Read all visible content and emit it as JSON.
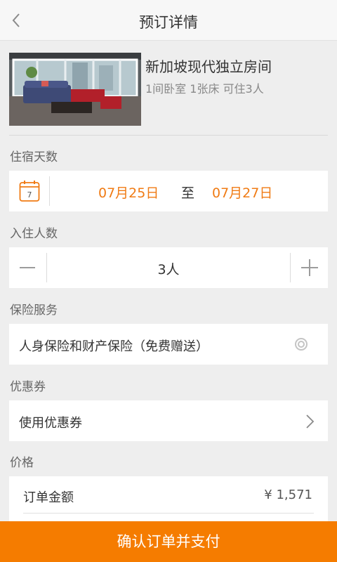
{
  "header": {
    "title": "预订详情",
    "back_icon": "chevron-left-icon"
  },
  "room": {
    "name": "新加坡现代独立房间",
    "meta": "1间卧室 1张床 可住3人"
  },
  "stay": {
    "label": "住宿天数",
    "calendar_day": "7",
    "check_in": "07月25日",
    "to": "至",
    "check_out": "07月27日"
  },
  "guests": {
    "label": "入住人数",
    "count": "3人"
  },
  "insurance": {
    "label": "保险服务",
    "text": "人身保险和财产保险（免费赠送）"
  },
  "coupon": {
    "label": "优惠券",
    "text": "使用优惠券"
  },
  "price": {
    "label": "价格",
    "order_label": "订单金额",
    "amount": "¥ 1,571"
  },
  "footer": {
    "pay_label": "确认订单并支付"
  },
  "colors": {
    "accent": "#f57c00",
    "date_text": "#f07b14",
    "background": "#eeeeee"
  }
}
